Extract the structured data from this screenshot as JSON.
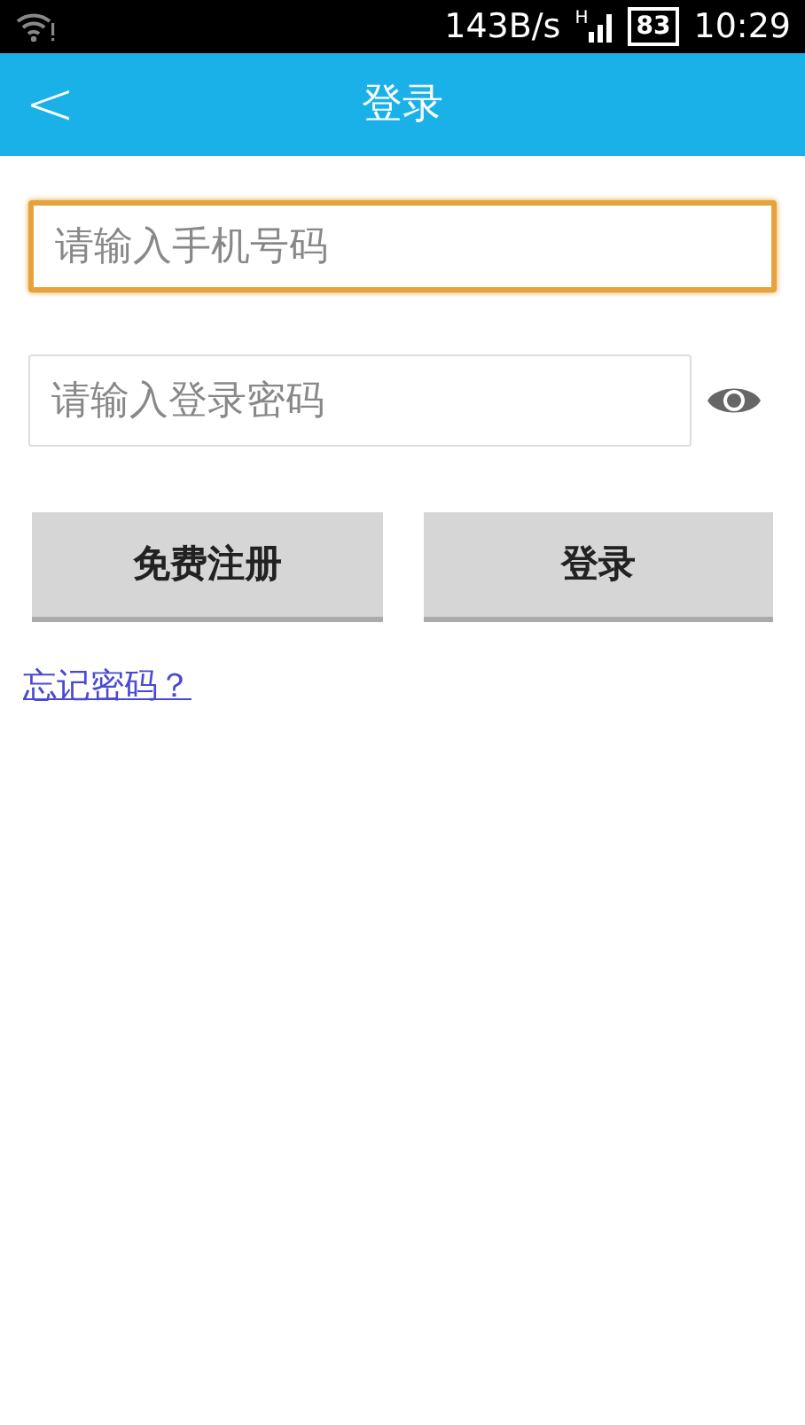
{
  "status_bar": {
    "speed": "143B/s",
    "network": "H",
    "battery": "83",
    "time": "10:29"
  },
  "header": {
    "back": "<",
    "title": "登录"
  },
  "fields": [
    {
      "placeholder": "请输入手机号码",
      "focused": true,
      "kind": "text"
    },
    {
      "placeholder": "请输入登录密码",
      "focused": false,
      "kind": "password"
    }
  ],
  "buttons": [
    "免费注册",
    "登录"
  ],
  "link": "忘记密码？"
}
